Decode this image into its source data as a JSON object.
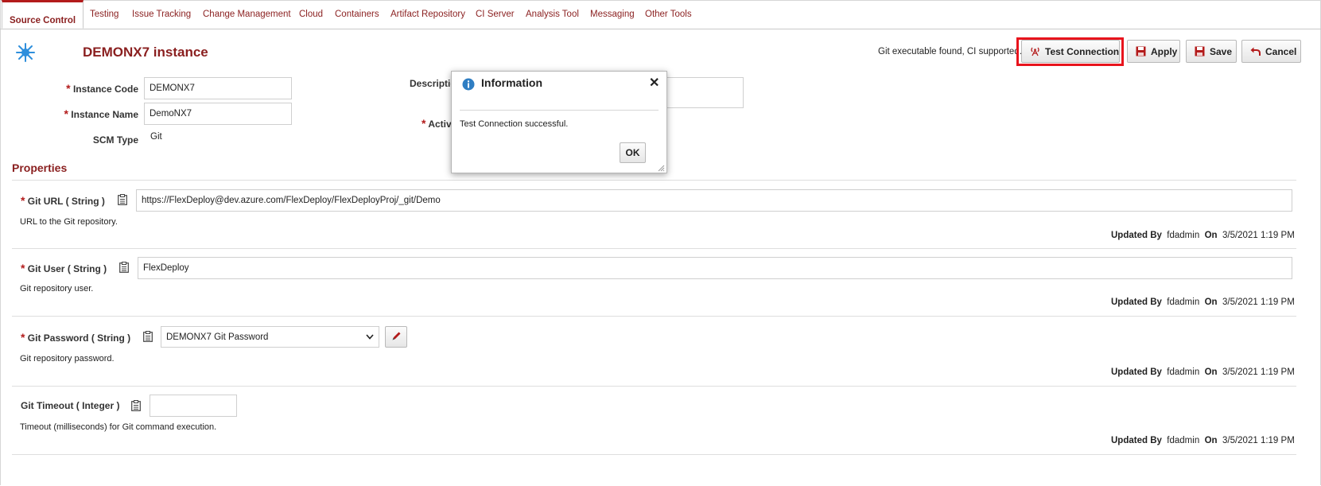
{
  "tabs": [
    {
      "label": "Source Control",
      "active": true
    },
    {
      "label": "Testing"
    },
    {
      "label": "Issue Tracking"
    },
    {
      "label": "Change Management"
    },
    {
      "label": "Cloud"
    },
    {
      "label": "Containers"
    },
    {
      "label": "Artifact Repository"
    },
    {
      "label": "CI Server"
    },
    {
      "label": "Analysis Tool"
    },
    {
      "label": "Messaging"
    },
    {
      "label": "Other Tools"
    }
  ],
  "header": {
    "title": "DEMONX7 instance",
    "status": "Git executable found, CI supported.",
    "logo_icon": "flexdeploy-logo-icon"
  },
  "toolbar": {
    "test_connection": "Test Connection",
    "apply": "Apply",
    "save": "Save",
    "cancel": "Cancel"
  },
  "form": {
    "instance_code_label": "Instance Code",
    "instance_code_value": "DEMONX7",
    "instance_name_label": "Instance Name",
    "instance_name_value": "DemoNX7",
    "scm_type_label": "SCM Type",
    "scm_type_value": "Git",
    "description_label": "Descriptio",
    "active_label": "Activ"
  },
  "properties": {
    "title": "Properties",
    "items": [
      {
        "label": "Git URL ( String )",
        "value": "https://FlexDeploy@dev.azure.com/FlexDeploy/FlexDeployProj/_git/Demo",
        "desc": "URL to the Git repository.",
        "updated_by_label": "Updated By",
        "updated_by": "fdadmin",
        "on_label": "On",
        "on": "3/5/2021 1:19 PM"
      },
      {
        "label": "Git User ( String )",
        "value": "FlexDeploy",
        "desc": "Git repository user.",
        "updated_by_label": "Updated By",
        "updated_by": "fdadmin",
        "on_label": "On",
        "on": "3/5/2021 1:19 PM"
      },
      {
        "label": "Git Password ( String )",
        "value": "DEMONX7 Git Password",
        "desc": "Git repository password.",
        "updated_by_label": "Updated By",
        "updated_by": "fdadmin",
        "on_label": "On",
        "on": "3/5/2021 1:19 PM"
      },
      {
        "label": "Git Timeout ( Integer )",
        "value": "",
        "desc": "Timeout (milliseconds) for Git command execution.",
        "updated_by_label": "Updated By",
        "updated_by": "fdadmin",
        "on_label": "On",
        "on": "3/5/2021 1:19 PM"
      }
    ]
  },
  "dialog": {
    "title": "Information",
    "message": "Test Connection successful.",
    "ok": "OK",
    "close": "✕"
  },
  "colors": {
    "accent": "#8a1f1f",
    "highlight": "#e8141d",
    "info": "#2f7ec3"
  }
}
